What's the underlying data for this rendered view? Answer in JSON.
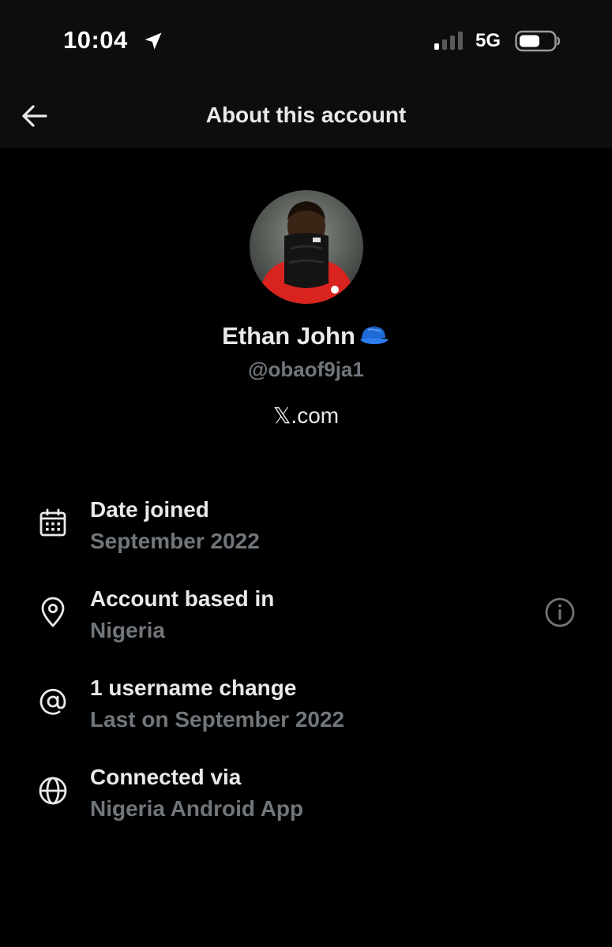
{
  "status_bar": {
    "time": "10:04",
    "network": "5G"
  },
  "header": {
    "title": "About this account"
  },
  "profile": {
    "name": "Ethan John",
    "handle": "@obaof9ja1",
    "site": "𝕏.com"
  },
  "info": [
    {
      "icon": "calendar-icon",
      "label": "Date joined",
      "value": "September 2022"
    },
    {
      "icon": "location-pin-icon",
      "label": "Account based in",
      "value": "Nigeria"
    },
    {
      "icon": "at-sign-icon",
      "label": "1 username change",
      "value": "Last on September 2022"
    },
    {
      "icon": "globe-icon",
      "label": "Connected via",
      "value": "Nigeria Android App"
    }
  ],
  "colors": {
    "background": "#000000",
    "bar": "#0d0d0d",
    "primary_text": "#e7e9ea",
    "secondary_text": "#71767b"
  }
}
